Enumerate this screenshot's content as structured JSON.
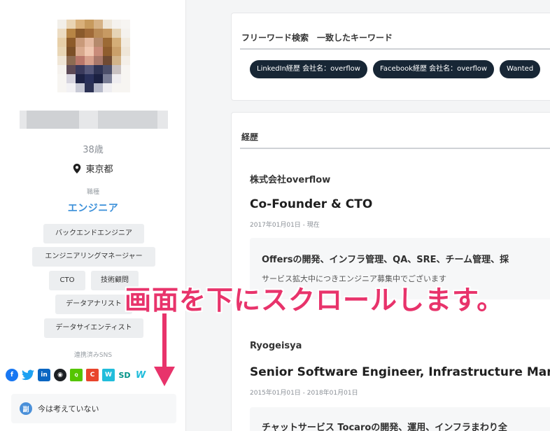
{
  "profile": {
    "age": "38歳",
    "location": "東京都",
    "job_caption": "職種",
    "job_title": "エンジニア",
    "tags": [
      "バックエンドエンジニア",
      "エンジニアリングマネージャー",
      "CTO",
      "技術顧問",
      "データアナリスト",
      "データサイエンティスト"
    ],
    "sns_caption": "連携済みSNS",
    "sns": [
      "facebook-icon",
      "twitter-icon",
      "linkedin-icon",
      "github-icon",
      "qiita-icon",
      "atcoder-icon",
      "wantedly-icon",
      "speakerdeck-icon",
      "wantedly-w-icon"
    ],
    "status": "今は考えていない",
    "status_icon": "副"
  },
  "keyword_search": {
    "title": "フリーワード検索　一致したキーワード",
    "keywords": [
      "LinkedIn経歴 会社名：overflow",
      "Facebook経歴 会社名：overflow",
      "Wanted"
    ]
  },
  "career": {
    "title": "経歴",
    "entries": [
      {
        "company": "株式会社overflow",
        "role": "Co-Founder & CTO",
        "period": "2017年01月01日 - 現在",
        "desc_heading": "Offersの開発、インフラ管理、QA、SRE、チーム管理、採",
        "desc_text": "サービス拡大中につきエンジニア募集中でございます"
      },
      {
        "company": "Ryogeisya",
        "role": "Senior Software Engineer, Infrastructure Man",
        "period": "2015年01月01日 - 2018年01月01日",
        "desc_heading": "チャットサービス Tocaroの開発、運用、インフラまわり全"
      }
    ]
  },
  "overlay": {
    "instruction": "画面を下にスクロールします。",
    "color": "#e8336b"
  },
  "colors": {
    "accent": "#3a8fd9",
    "keyword_bg": "#172635"
  }
}
